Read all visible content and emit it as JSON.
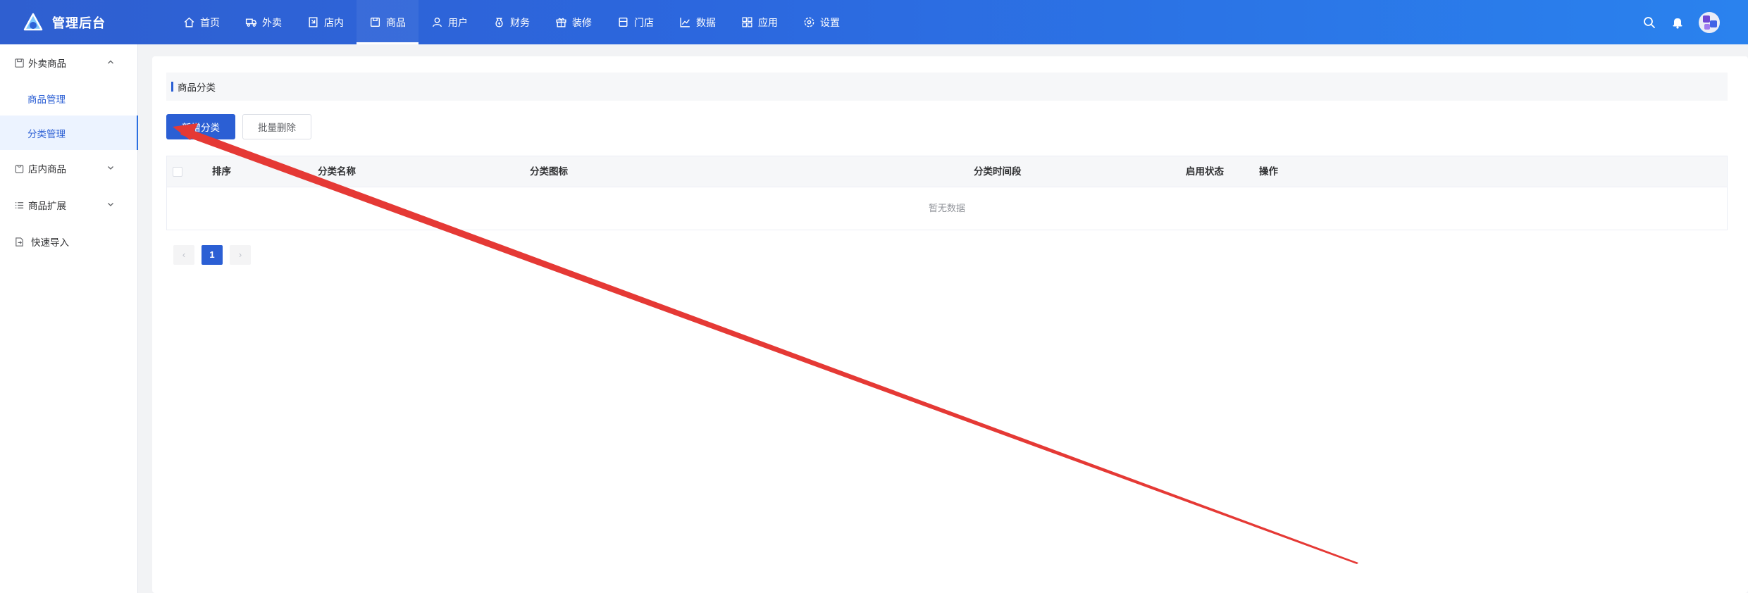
{
  "app": {
    "title": "管理后台"
  },
  "nav": {
    "items": [
      {
        "label": "首页",
        "icon": "home-icon"
      },
      {
        "label": "外卖",
        "icon": "delivery-icon"
      },
      {
        "label": "店内",
        "icon": "dine-in-icon"
      },
      {
        "label": "商品",
        "icon": "goods-icon",
        "active": true
      },
      {
        "label": "用户",
        "icon": "user-icon"
      },
      {
        "label": "财务",
        "icon": "finance-icon"
      },
      {
        "label": "装修",
        "icon": "decoration-icon"
      },
      {
        "label": "门店",
        "icon": "store-icon"
      },
      {
        "label": "数据",
        "icon": "chart-icon"
      },
      {
        "label": "应用",
        "icon": "apps-icon"
      },
      {
        "label": "设置",
        "icon": "gear-icon"
      }
    ]
  },
  "sidebar": {
    "groups": [
      {
        "label": "外卖商品",
        "icon": "goods-icon",
        "expanded": true,
        "children": [
          {
            "label": "商品管理"
          },
          {
            "label": "分类管理",
            "active": true
          }
        ]
      },
      {
        "label": "店内商品",
        "icon": "bag-icon",
        "expanded": false
      },
      {
        "label": "商品扩展",
        "icon": "list-icon",
        "expanded": false
      },
      {
        "label": "快速导入",
        "icon": "import-icon"
      }
    ]
  },
  "main": {
    "section_title": "商品分类",
    "buttons": {
      "add": "新增分类",
      "batch_delete": "批量删除"
    },
    "table": {
      "columns": [
        "排序",
        "分类名称",
        "分类图标",
        "分类时间段",
        "启用状态",
        "操作"
      ],
      "rows": [],
      "empty_text": "暂无数据"
    },
    "pagination": {
      "prev": "‹",
      "current": "1",
      "next": "›"
    }
  },
  "colors": {
    "primary": "#2b5fd4",
    "annotation_arrow": "#e53935"
  }
}
